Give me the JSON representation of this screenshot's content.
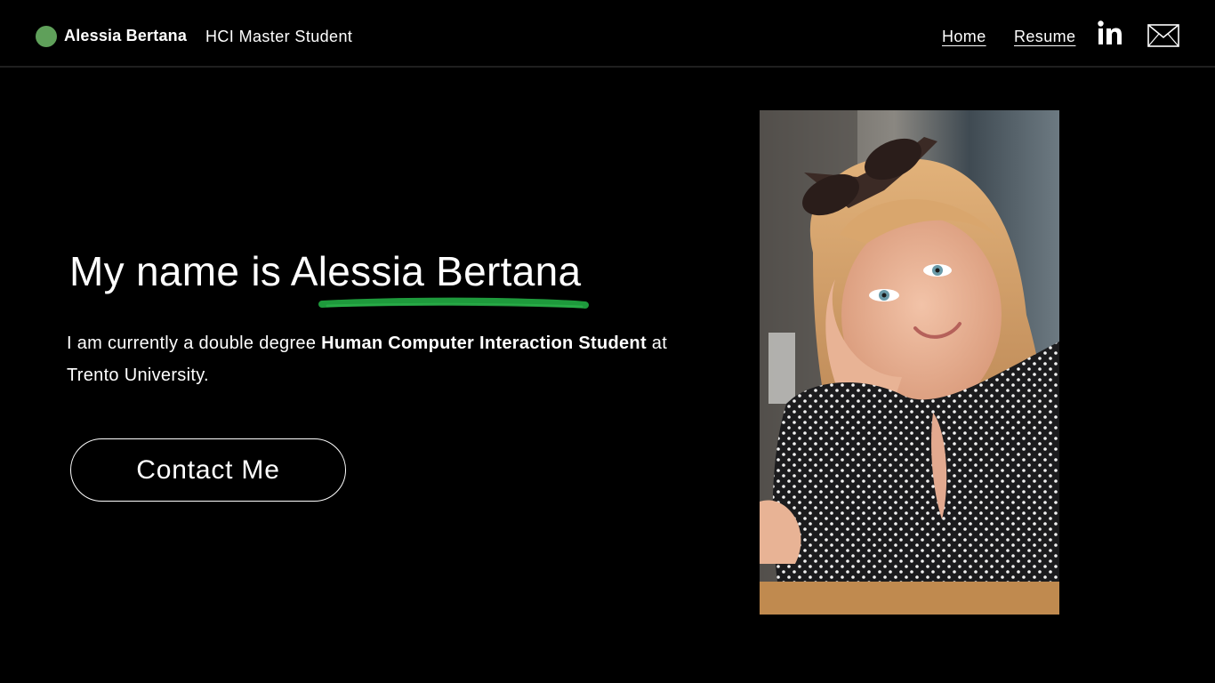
{
  "header": {
    "brand_name": "Alessia Bertana",
    "brand_subtitle": "HCI Master Student",
    "nav": {
      "home": "Home",
      "resume": "Resume"
    },
    "icons": [
      "linkedin-icon",
      "mail-icon"
    ]
  },
  "hero": {
    "title": "My name is Alessia Bertana",
    "desc_part1": "I am currently a double degree ",
    "desc_bold1": "Human Computer Interaction Student",
    "desc_part2": " at Trento University.",
    "contact_label": "Contact Me"
  },
  "colors": {
    "accent": "#5fa05a",
    "underline": "#1e9a3c",
    "background": "#000000"
  }
}
